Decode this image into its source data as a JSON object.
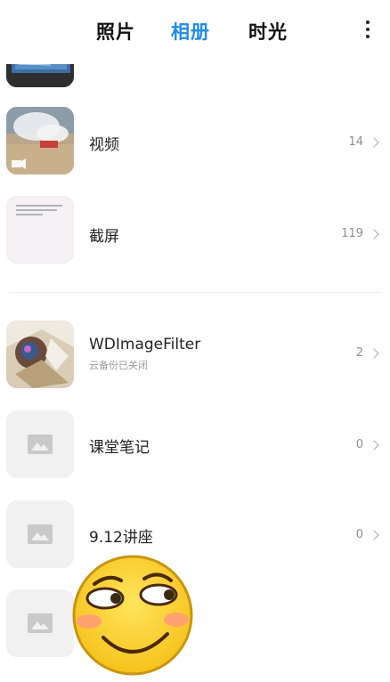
{
  "tabs": {
    "photos": "照片",
    "albums": "相册",
    "moments": "时光",
    "active": "albums"
  },
  "albums": [
    {
      "title": "视频",
      "count": "14"
    },
    {
      "title": "截屏",
      "count": "119"
    },
    {
      "title": "WDImageFilter",
      "subtitle": "云备份已关闭",
      "count": "2"
    },
    {
      "title": "课堂笔记",
      "count": "0"
    },
    {
      "title": "9.12讲座",
      "count": "0"
    }
  ],
  "colors": {
    "accent": "#1f8be8",
    "count": "#8f8f8f"
  },
  "icons": {
    "more": "more-vertical-icon",
    "chevron": "chevron-right-icon",
    "placeholder": "image-placeholder-icon"
  }
}
